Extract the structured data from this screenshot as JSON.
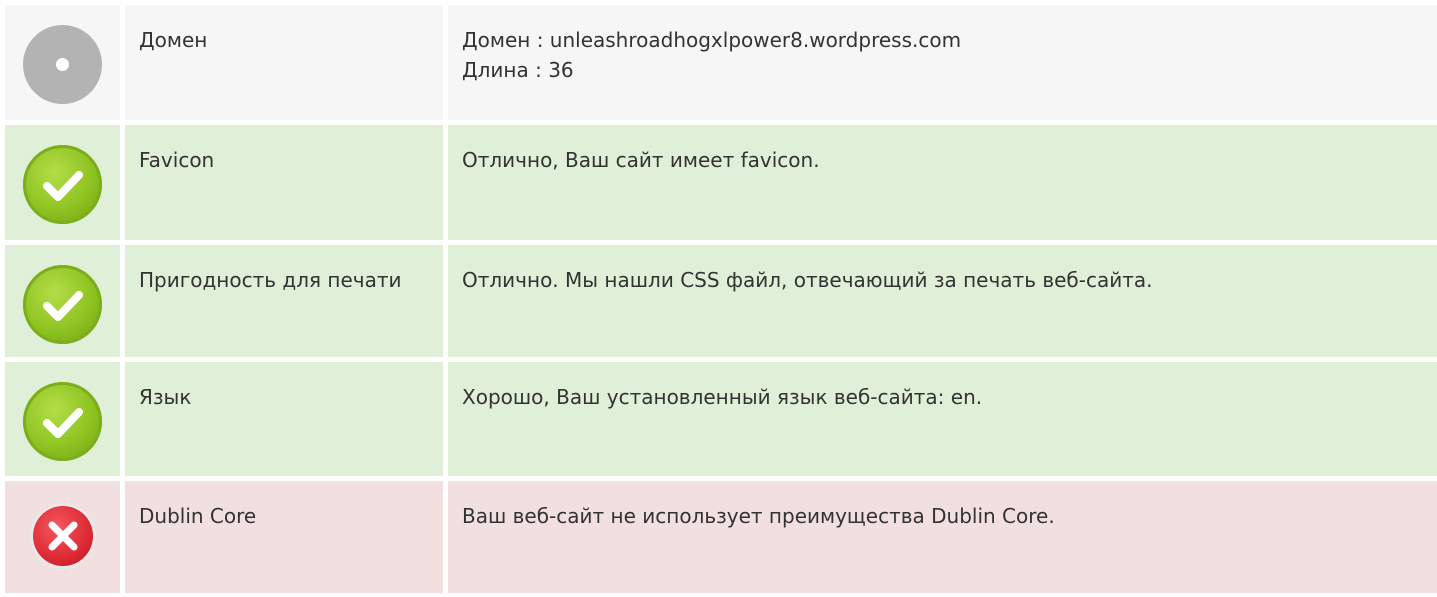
{
  "colors": {
    "neutral_bg": "#f6f6f6",
    "ok_bg": "#dfefd8",
    "fail_bg": "#f2dfe0",
    "ok_icon": "#8dc320",
    "fail_icon": "#dd2a35",
    "neutral_icon": "#b3b3b3"
  },
  "rows": [
    {
      "status": "neutral",
      "icon": "neutral-dot-icon",
      "name": "Домен",
      "value_lines": [
        "Домен : unleashroadhogxlpower8.wordpress.com",
        "Длина : 36"
      ]
    },
    {
      "status": "ok",
      "icon": "checkmark-icon",
      "name": "Favicon",
      "value_lines": [
        "Отлично, Ваш сайт имеет favicon."
      ]
    },
    {
      "status": "ok",
      "icon": "checkmark-icon",
      "name": "Пригодность для печати",
      "value_lines": [
        "Отлично. Мы нашли CSS файл, отвечающий за печать веб-сайта."
      ]
    },
    {
      "status": "ok",
      "icon": "checkmark-icon",
      "name": "Язык",
      "value_lines": [
        "Хорошо, Ваш установленный язык веб-сайта: en."
      ]
    },
    {
      "status": "fail",
      "icon": "cross-icon",
      "name": "Dublin Core",
      "value_lines": [
        "Ваш веб-сайт не использует преимущества Dublin Core."
      ]
    }
  ]
}
